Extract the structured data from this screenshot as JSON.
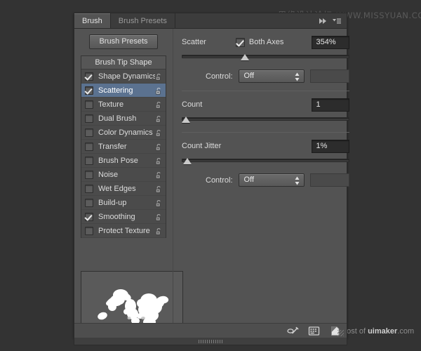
{
  "app": {
    "panel_title": "Brush",
    "theme_colors": {
      "workspace_bg": "#333333",
      "panel_bg": "#535353",
      "tabbar_bg": "#3c3c3c",
      "list_bg": "#4b4b4b",
      "selection": "#5b7290",
      "field_bg": "#2c2c2c",
      "text": "#dcdcdc"
    }
  },
  "tabs": [
    {
      "label": "Brush",
      "active": true
    },
    {
      "label": "Brush Presets",
      "active": false
    }
  ],
  "tab_icons": [
    {
      "name": "collapse-to-icons-icon",
      "glyph": "▶▶"
    },
    {
      "name": "panel-menu-icon",
      "glyph": "☰"
    }
  ],
  "left": {
    "presets_button": "Brush Presets",
    "list_header": "Brush Tip Shape",
    "items": [
      {
        "label": "Shape Dynamics",
        "checked": true,
        "selected": false,
        "locked": false
      },
      {
        "label": "Scattering",
        "checked": true,
        "selected": true,
        "locked": false
      },
      {
        "label": "Texture",
        "checked": false,
        "selected": false,
        "locked": false
      },
      {
        "label": "Dual Brush",
        "checked": false,
        "selected": false,
        "locked": false
      },
      {
        "label": "Color Dynamics",
        "checked": false,
        "selected": false,
        "locked": false
      },
      {
        "label": "Transfer",
        "checked": false,
        "selected": false,
        "locked": false
      },
      {
        "label": "Brush Pose",
        "checked": false,
        "selected": false,
        "locked": false
      },
      {
        "label": "Noise",
        "checked": false,
        "selected": false,
        "locked": false
      },
      {
        "label": "Wet Edges",
        "checked": false,
        "selected": false,
        "locked": false
      },
      {
        "label": "Build-up",
        "checked": false,
        "selected": false,
        "locked": false
      },
      {
        "label": "Smoothing",
        "checked": true,
        "selected": false,
        "locked": false
      },
      {
        "label": "Protect Texture",
        "checked": false,
        "selected": false,
        "locked": false
      }
    ],
    "preview_alt": "brush-stroke-preview"
  },
  "right": {
    "scatter": {
      "label": "Scatter",
      "both_axes_label": "Both Axes",
      "both_axes_checked": true,
      "value": "354%",
      "slider_percent": 37,
      "control_label": "Control:",
      "control_value": "Off"
    },
    "count": {
      "label": "Count",
      "value": "1",
      "slider_percent": 0
    },
    "count_jitter": {
      "label": "Count Jitter",
      "value": "1%",
      "slider_percent": 1,
      "control_label": "Control:",
      "control_value": "Off"
    }
  },
  "footer_icons": [
    {
      "name": "toggle-brush-tip-icon"
    },
    {
      "name": "new-brush-preset-grid-icon"
    },
    {
      "name": "create-new-brush-icon"
    }
  ],
  "watermarks": {
    "top_cn": "思缘设计论坛",
    "top_en": "WWW.MISSYUAN.COM",
    "bottom_prefix": "post of ",
    "bottom_brand": "uimaker",
    "bottom_suffix": ".com"
  }
}
